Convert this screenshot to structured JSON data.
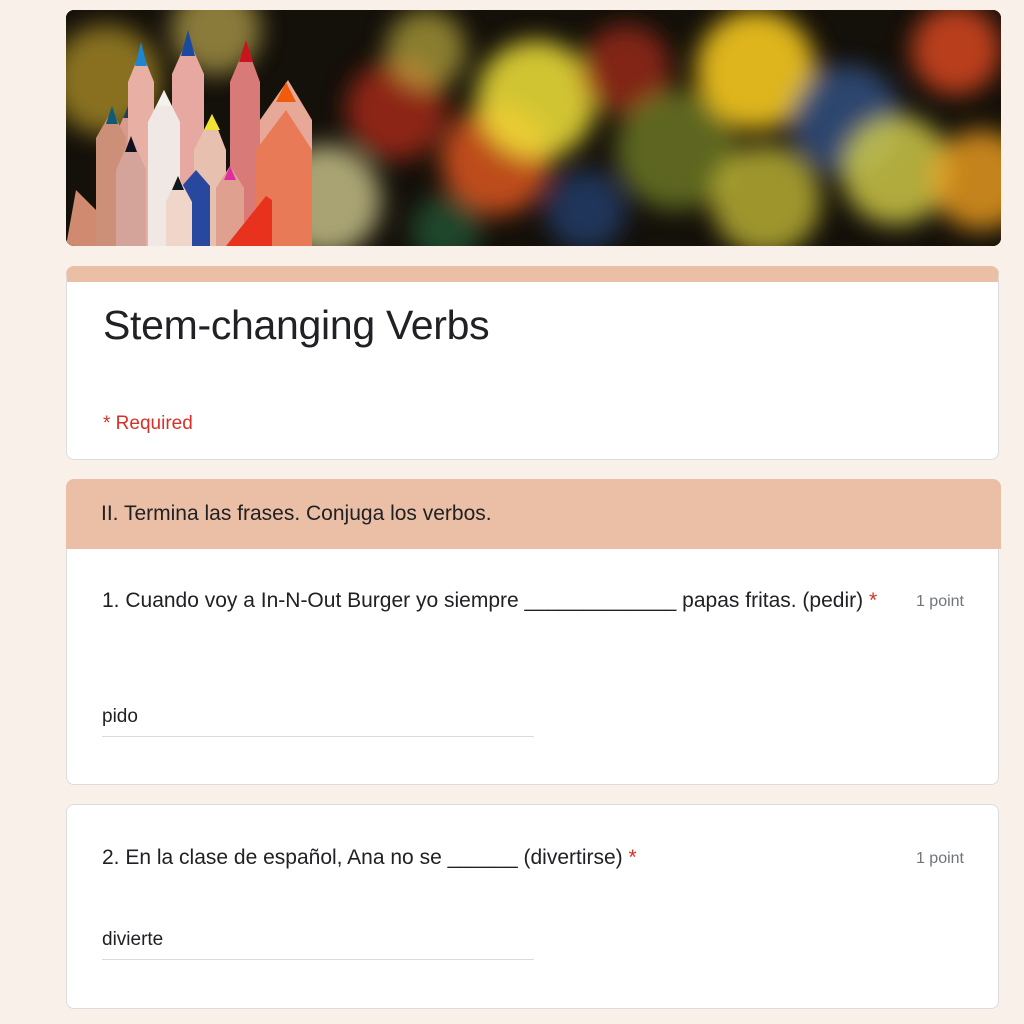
{
  "form": {
    "title": "Stem-changing Verbs",
    "required_note": "* Required"
  },
  "section": {
    "title": "II. Termina las frases. Conjuga los verbos."
  },
  "questions": [
    {
      "text": "1. Cuando voy a In-N-Out Burger yo siempre _____________ papas fritas. (pedir)",
      "required_mark": "*",
      "points": "1 point",
      "answer": "pido"
    },
    {
      "text": "2. En la clase de español, Ana no se ______ (divertirse)",
      "required_mark": "*",
      "points": "1 point",
      "answer": "divierte"
    }
  ],
  "theme": {
    "accent": "#ebbfa5",
    "required_color": "#d93025",
    "background": "#faf0ea"
  }
}
